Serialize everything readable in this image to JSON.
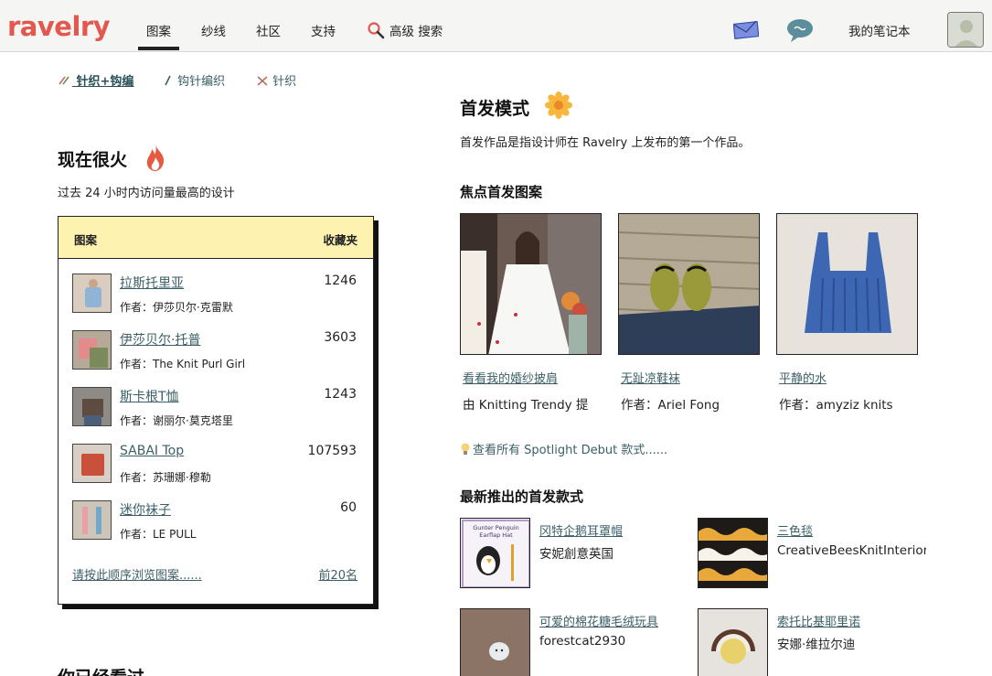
{
  "brand": {
    "logo": "ravelry",
    "color": "#e2584f"
  },
  "nav": {
    "tabs": [
      {
        "label": "图案",
        "active": true
      },
      {
        "label": "纱线"
      },
      {
        "label": "社区"
      },
      {
        "label": "支持"
      }
    ],
    "search_label": "高级 搜索",
    "notebook_label": "我的笔记本",
    "icons": [
      "search-icon",
      "mail-icon",
      "chat-icon",
      "avatar"
    ]
  },
  "craft_tabs": [
    {
      "label": "针织+钩编",
      "active": true,
      "icon": "knit-crochet-icon"
    },
    {
      "label": "钩针编织",
      "icon": "crochet-hook-icon"
    },
    {
      "label": "针织",
      "icon": "knitting-needles-icon"
    }
  ],
  "hot": {
    "title": "现在很火",
    "subtitle": "过去 24 小时内访问量最高的设计",
    "col_pattern": "图案",
    "col_favorites": "收藏夹",
    "rows": [
      {
        "name": "拉斯托里亚",
        "author": "作者：伊莎贝尔·克雷默",
        "count": "1246"
      },
      {
        "name": "伊莎贝尔·托普",
        "author": "作者：The Knit Purl Girl",
        "count": "3603"
      },
      {
        "name": "斯卡根T恤",
        "author": "作者：谢丽尔·莫克塔里",
        "count": "1243"
      },
      {
        "name": "SABAI Top",
        "author": "作者：苏珊娜·穆勒",
        "count": "107593"
      },
      {
        "name": "迷你袜子",
        "author": "作者：LE PULL",
        "count": "60"
      }
    ],
    "browse_link": "请按此顺序浏览图案......",
    "top20_link": "前20名"
  },
  "seen": {
    "title": "你已经看过"
  },
  "debut": {
    "title": "首发模式",
    "desc": "首发作品是指设计师在 Ravelry 上发布的第一个作品。",
    "focus_title": "焦点首发图案",
    "focus": [
      {
        "title": "看看我的婚纱披肩",
        "author": "由 Knitting Trendy 提"
      },
      {
        "title": "无趾凉鞋袜",
        "author": "作者：Ariel Fong"
      },
      {
        "title": "平静的水",
        "author": "作者：amyziz knits"
      }
    ],
    "see_all": "查看所有 Spotlight Debut 款式......",
    "latest_title": "最新推出的首发款式",
    "latest": [
      {
        "title": "冈特企鹅耳罩帽",
        "author": "安妮創意英国",
        "thumb_text": [
          "Gunter Penguin",
          "Earflap Hat"
        ]
      },
      {
        "title": "三色毯",
        "author": "CreativeBeesKnitInteriors"
      },
      {
        "title": "可爱的棉花糖毛绒玩具",
        "author": "forestcat2930"
      },
      {
        "title": "索托比基耶里诺",
        "author": "安娜·维拉尔迪"
      }
    ]
  },
  "colors": {
    "link": "#3b5f67",
    "card_header": "#fdf2b0",
    "nav_bg": "#f5f5f3"
  }
}
